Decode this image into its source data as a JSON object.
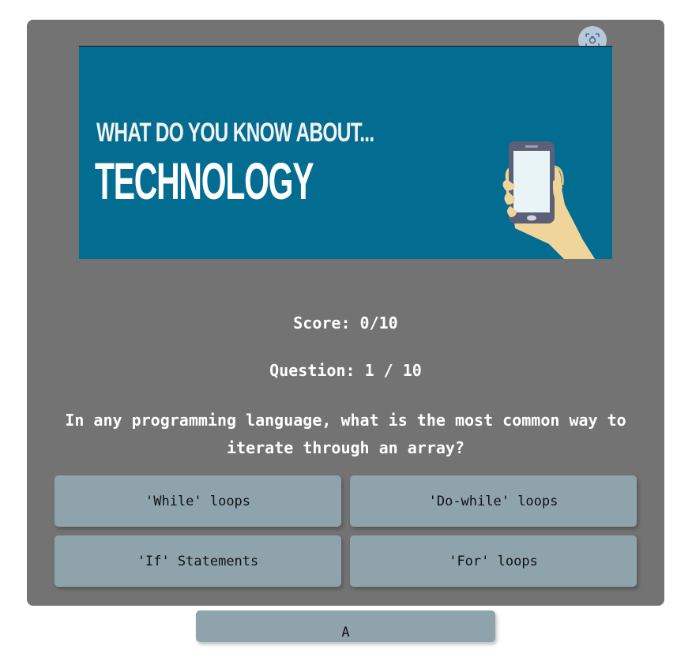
{
  "banner": {
    "line1": "WHAT DO YOU KNOW ABOUT...",
    "line2": "TECHNOLOGY",
    "icon": "phone-in-hand"
  },
  "lens_button": {
    "icon": "camera-lens-icon"
  },
  "quiz": {
    "score": "Score: 0/10",
    "question_number": "Question: 1 / 10",
    "question": "In any programming language, what is the most common way to iterate through an array?",
    "answers": [
      "'While' loops",
      "'Do-while' loops",
      "'If' Statements",
      "'For' loops"
    ]
  },
  "next_button": {
    "label": "A"
  },
  "colors": {
    "card": "#737373",
    "banner": "#036d91",
    "button": "#8fa3ad"
  }
}
